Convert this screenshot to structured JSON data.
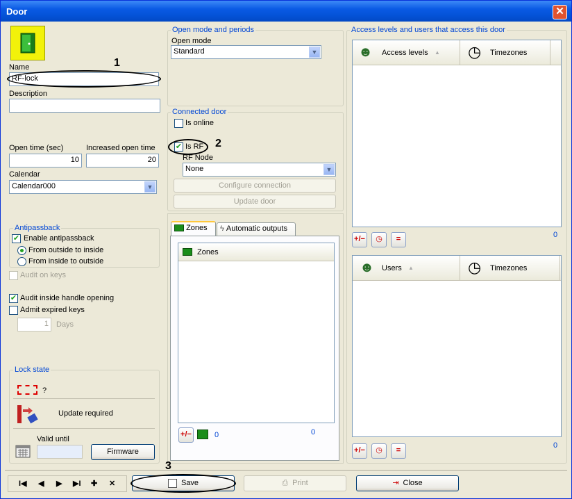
{
  "window": {
    "title": "Door",
    "close_glyph": "✕"
  },
  "left": {
    "name_label": "Name",
    "name_value": "RF-lock",
    "description_label": "Description",
    "description_value": "",
    "open_time_label": "Open time (sec)",
    "open_time_value": "10",
    "increased_open_time_label": "Increased open time",
    "increased_open_time_value": "20",
    "calendar_label": "Calendar",
    "calendar_value": "Calendar000",
    "antipassback": {
      "title": "Antipassback",
      "enable_label": "Enable antipassback",
      "from_outside_label": "From outside to inside",
      "from_inside_label": "From inside to outside"
    },
    "audit_on_keys_label": "Audit on keys",
    "audit_inside_label": "Audit inside handle opening",
    "admit_expired_label": "Admit expired keys",
    "days_value": "1",
    "days_label": "Days",
    "lock_state": {
      "title": "Lock state",
      "question": "?",
      "update_required": "Update required",
      "valid_until_label": "Valid until",
      "valid_until_value": "",
      "firmware_label": "Firmware"
    }
  },
  "middle": {
    "open_mode_group_title": "Open mode and periods",
    "open_mode_label": "Open mode",
    "open_mode_value": "Standard",
    "connected_door_title": "Connected door",
    "is_online_label": "Is online",
    "is_rf_label": "Is RF",
    "rf_node_label": "RF Node",
    "rf_node_value": "None",
    "configure_connection_label": "Configure connection",
    "update_door_label": "Update door",
    "tabs": [
      {
        "label": "Zones"
      },
      {
        "label": "Automatic outputs"
      }
    ],
    "zones_column": "Zones",
    "zones_count_left": "0",
    "zones_count_right": "0"
  },
  "right": {
    "group_title": "Access levels and users that access this door",
    "access_levels_col": "Access levels",
    "timezones_col": "Timezones",
    "access_count": "0",
    "users_col": "Users",
    "users_timezones_col": "Timezones",
    "users_count": "0"
  },
  "bottom": {
    "nav_first": "I◀",
    "nav_prev": "◀",
    "nav_next": "▶",
    "nav_last": "▶I",
    "nav_add": "✚",
    "nav_delete": "✕",
    "save_label": "Save",
    "print_label": "Print",
    "close_label": "Close"
  },
  "annotations": {
    "one": "1",
    "two": "2",
    "three": "3"
  },
  "colors": {
    "titlebar": "#0a5ae4",
    "group_title": "#0046d5",
    "window_bg": "#ece9d8"
  }
}
